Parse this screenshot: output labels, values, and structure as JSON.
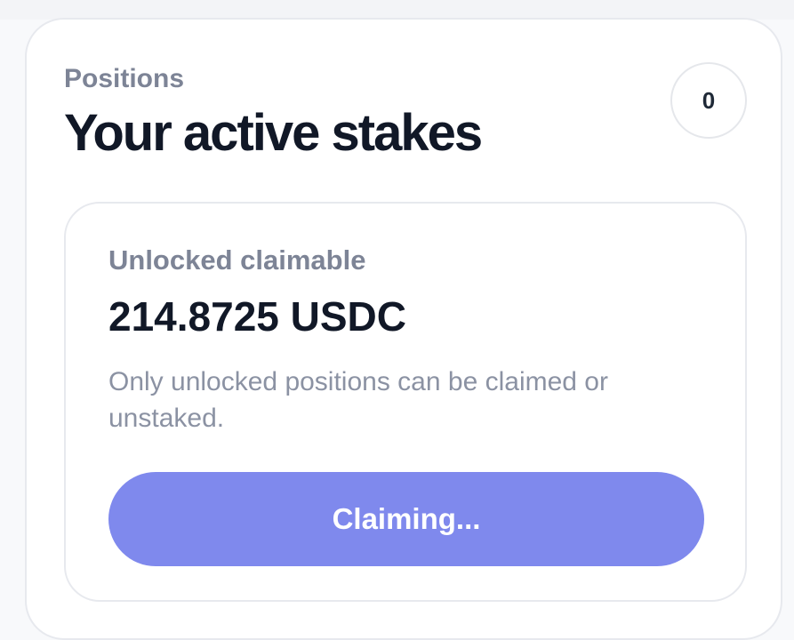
{
  "positions": {
    "eyebrow": "Positions",
    "title": "Your active stakes",
    "count": "0"
  },
  "claimable": {
    "label": "Unlocked claimable",
    "amount": "214.8725 USDC",
    "note": "Only unlocked positions can be claimed or unstaked.",
    "button_label": "Claiming...",
    "button_state": "disabled"
  },
  "colors": {
    "button": "#7f89ed",
    "title": "#111827",
    "muted": "#7d8496"
  }
}
